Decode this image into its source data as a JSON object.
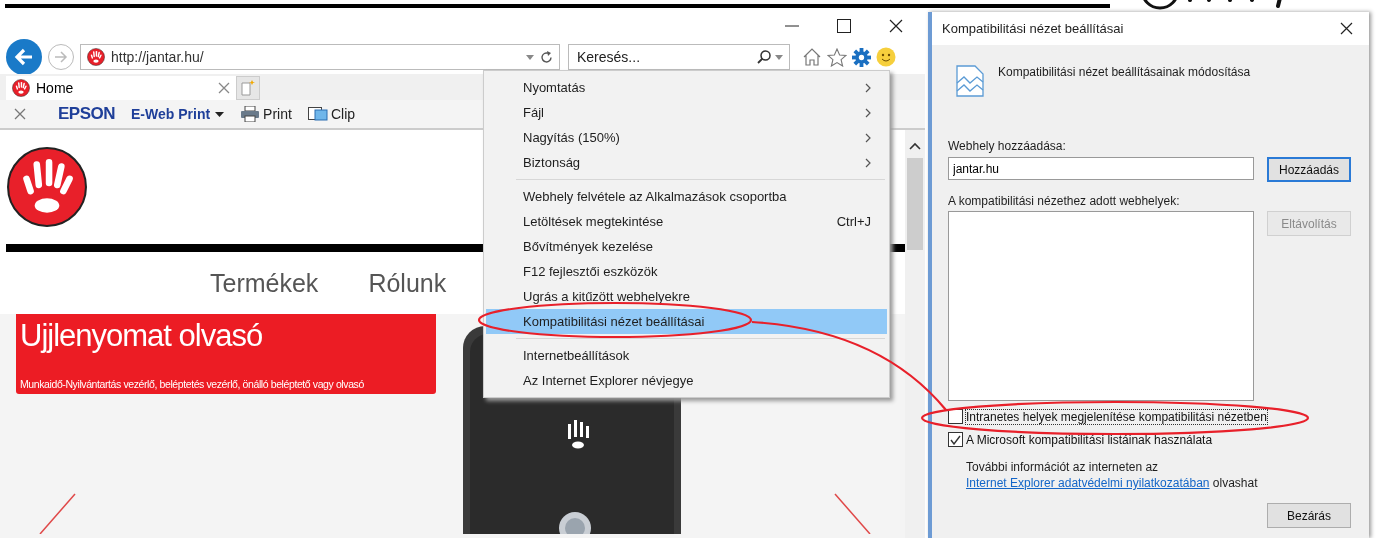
{
  "browser": {
    "address": "http://jantar.hu/",
    "search": {
      "placeholder": "Keresés..."
    },
    "tabs": [
      {
        "label": "Home",
        "selected": true
      }
    ],
    "toolbar": {
      "brand": "EPSON",
      "items": [
        {
          "label": "E-Web Print",
          "kind": "dropdown"
        },
        {
          "label": "Print",
          "kind": "print"
        },
        {
          "label": "Clip",
          "kind": "clip"
        }
      ]
    },
    "page": {
      "nav": [
        "Termékek",
        "Rólunk"
      ],
      "banner": {
        "title": "Ujjlenyomat olvasó",
        "subtitle": "Munkaidő-Nyilvántartás vezérlő, beléptetés vezérlő, önálló beléptető vagy olvasó"
      },
      "hero": {
        "kind": "picture"
      }
    }
  },
  "menu": {
    "groups": [
      {
        "items": [
          {
            "label": "Nyomtatás",
            "submenu": true,
            "selected": false
          },
          {
            "label": "Fájl",
            "submenu": true,
            "selected": false
          },
          {
            "label": "Nagyítás (150%)",
            "submenu": true,
            "selected": false
          },
          {
            "label": "Biztonság",
            "submenu": true,
            "selected": false
          }
        ]
      },
      {
        "items": [
          {
            "label": "Webhely felvétele az Alkalmazások csoportba",
            "submenu": false,
            "selected": false
          },
          {
            "label": "Letöltések megtekintése",
            "shortcut": "Ctrl+J",
            "submenu": false,
            "selected": false
          },
          {
            "label": "Bővítmények kezelése",
            "submenu": false,
            "selected": false
          },
          {
            "label": "F12 fejlesztői eszközök",
            "submenu": false,
            "selected": false
          },
          {
            "label": "Ugrás a kitűzött webhelyekre",
            "submenu": false,
            "selected": false
          },
          {
            "label": "Kompatibilitási nézet beállításai",
            "submenu": false,
            "selected": true
          }
        ]
      },
      {
        "items": [
          {
            "label": "Internetbeállítások",
            "submenu": false,
            "selected": false
          },
          {
            "label": "Az Internet Explorer névjegye",
            "submenu": false,
            "selected": false
          }
        ]
      }
    ]
  },
  "dialog": {
    "title": "Kompatibilitási nézet beállításai",
    "heading": "Kompatibilitási nézet beállításainak módosítása",
    "add_label": "Webhely hozzáadása:",
    "add_value": "jantar.hu",
    "add_button": {
      "label": "Hozzáadás",
      "disabled": false
    },
    "list_label": "A kompatibilitási nézethez adott webhelyek:",
    "remove_button": {
      "label": "Eltávolítás",
      "disabled": true
    },
    "checkboxes": [
      {
        "label": "Intranetes helyek megjelenítése kompatibilitási nézetben",
        "checked": false
      },
      {
        "label": "A Microsoft kompatibilitási listáinak használata",
        "checked": true
      }
    ],
    "info": {
      "text": "További információt az interneten az",
      "link": "Internet Explorer adatvédelmi nyilatkozatában",
      "after": "olvashat"
    },
    "close_button": {
      "label": "Bezárás",
      "disabled": false
    }
  }
}
